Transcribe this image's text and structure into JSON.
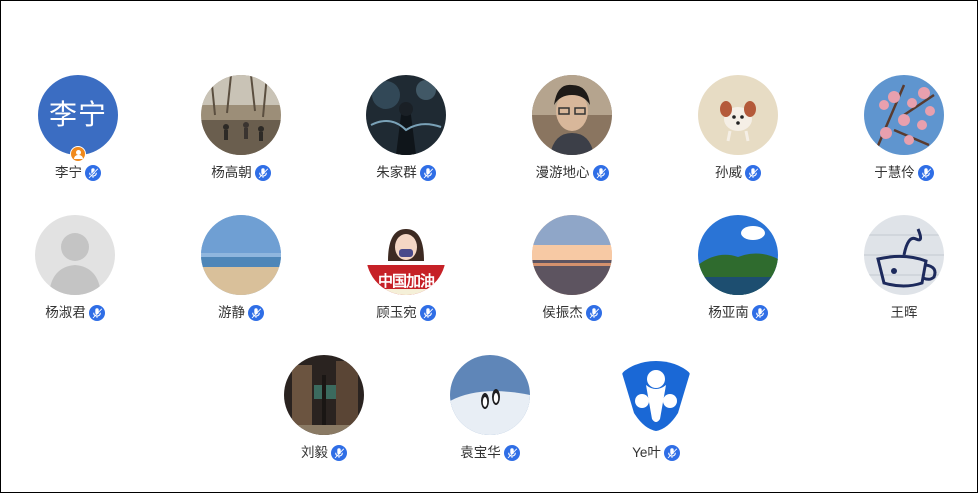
{
  "users": [
    {
      "name": "李宁",
      "avatar_text": "李宁",
      "avatar_kind": "text",
      "has_badge": true,
      "verified": true
    },
    {
      "name": "杨高朝",
      "avatar_kind": "crowd-photo",
      "verified": true
    },
    {
      "name": "朱家群",
      "avatar_kind": "dark-photo",
      "verified": true
    },
    {
      "name": "漫游地心",
      "avatar_kind": "man-photo",
      "verified": true
    },
    {
      "name": "孙威",
      "avatar_kind": "dog-photo",
      "verified": true
    },
    {
      "name": "于慧伶",
      "avatar_kind": "blossom-photo",
      "verified": true
    },
    {
      "name": "杨淑君",
      "avatar_kind": "default-person",
      "verified": true
    },
    {
      "name": "游静",
      "avatar_kind": "beach-photo",
      "verified": true
    },
    {
      "name": "顾玉宛",
      "avatar_text": "中国加油",
      "avatar_kind": "girl-cheer",
      "verified": true
    },
    {
      "name": "侯振杰",
      "avatar_kind": "sunset-photo",
      "verified": true
    },
    {
      "name": "杨亚南",
      "avatar_kind": "island-photo",
      "verified": true
    },
    {
      "name": "王晖",
      "avatar_kind": "cup-sketch",
      "verified": false
    },
    {
      "name": "刘毅",
      "avatar_kind": "street-photo",
      "verified": true
    },
    {
      "name": "袁宝华",
      "avatar_kind": "penguin-photo",
      "verified": true
    },
    {
      "name": "Ye叶",
      "avatar_kind": "logo",
      "verified": true
    }
  ],
  "colors": {
    "text_avatar_bg": "#3b6dc2",
    "verified_badge": "#2f6ee6",
    "user_badge": "#f08a1d"
  }
}
